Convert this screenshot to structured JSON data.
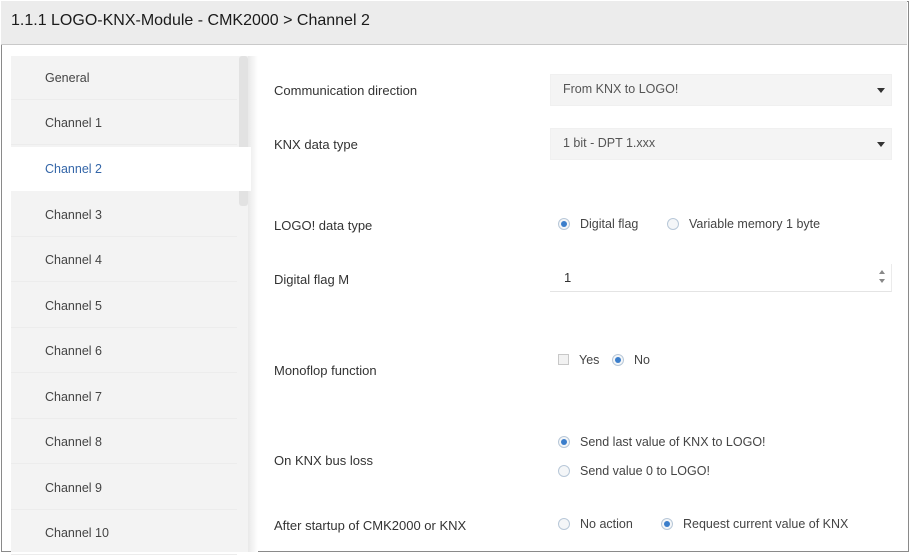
{
  "window": {
    "title": "1.1.1 LOGO-KNX-Module - CMK2000 > Channel 2"
  },
  "sidebar": {
    "items": [
      {
        "label": "General"
      },
      {
        "label": "Channel 1"
      },
      {
        "label": "Channel 2",
        "active": true
      },
      {
        "label": "Channel 3"
      },
      {
        "label": "Channel 4"
      },
      {
        "label": "Channel 5"
      },
      {
        "label": "Channel 6"
      },
      {
        "label": "Channel 7"
      },
      {
        "label": "Channel 8"
      },
      {
        "label": "Channel 9"
      },
      {
        "label": "Channel 10"
      }
    ]
  },
  "params": {
    "comm_direction": {
      "label": "Communication direction",
      "value": "From KNX to LOGO!"
    },
    "knx_type": {
      "label": "KNX data type",
      "value": "1 bit - DPT 1.xxx"
    },
    "logo_type": {
      "label": "LOGO! data type",
      "opt1": "Digital flag",
      "opt2": "Variable memory 1 byte",
      "selected": "Digital flag"
    },
    "digital_flag": {
      "label": "Digital flag  M",
      "value": "1"
    },
    "monoflop": {
      "label": "Monoflop function",
      "opt1": "Yes",
      "opt2": "No",
      "selected": "No"
    },
    "bus_loss": {
      "label": "On KNX bus loss",
      "opt1": "Send last value of KNX to LOGO!",
      "opt2": "Send value 0 to LOGO!",
      "selected": "Send last value of KNX to LOGO!"
    },
    "startup": {
      "label": "After startup of CMK2000 or KNX",
      "opt1": "No action",
      "opt2": "Request current value of KNX",
      "selected": "Request current value of KNX"
    }
  },
  "colors": {
    "accent": "#3466a8",
    "radio_selected": "#3b7ecb"
  }
}
